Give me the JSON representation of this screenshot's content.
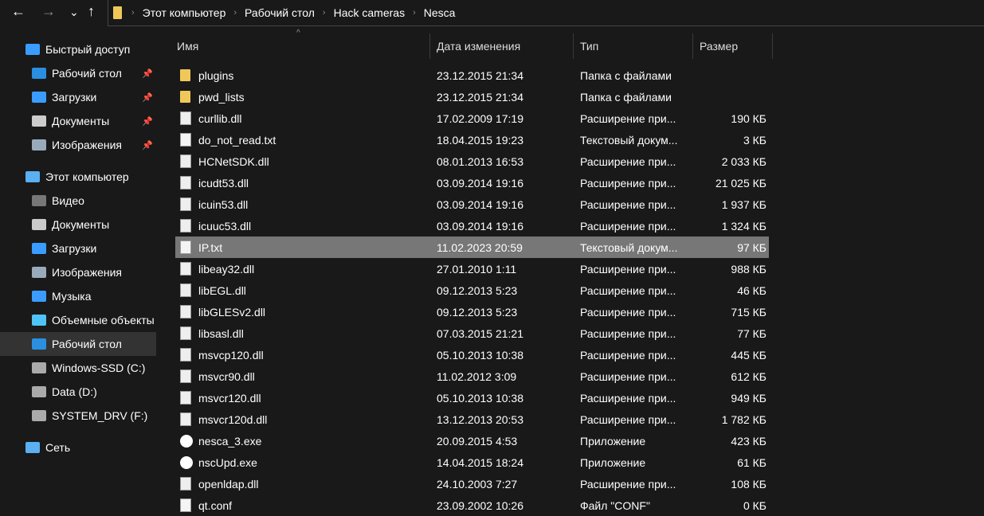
{
  "nav": {
    "back": "←",
    "forward": "→",
    "recent": "⌄",
    "up": "↑"
  },
  "breadcrumb": [
    "Этот компьютер",
    "Рабочий стол",
    "Hack cameras",
    "Nesca"
  ],
  "sidebar": [
    {
      "label": "Быстрый доступ",
      "icon": "star-icon",
      "color": "#3b9cff",
      "pin": false,
      "indent": false
    },
    {
      "label": "Рабочий стол",
      "icon": "desktop-icon",
      "color": "#2a8fe0",
      "pin": true,
      "indent": true
    },
    {
      "label": "Загрузки",
      "icon": "download-icon",
      "color": "#3b9cff",
      "pin": true,
      "indent": true
    },
    {
      "label": "Документы",
      "icon": "document-icon",
      "color": "#ccc",
      "pin": true,
      "indent": true
    },
    {
      "label": "Изображения",
      "icon": "pictures-icon",
      "color": "#9ab",
      "pin": true,
      "indent": true
    },
    {
      "label": "Этот компьютер",
      "icon": "computer-icon",
      "color": "#5ab0f0",
      "pin": false,
      "indent": false
    },
    {
      "label": "Видео",
      "icon": "video-icon",
      "color": "#777",
      "pin": false,
      "indent": true
    },
    {
      "label": "Документы",
      "icon": "document-icon",
      "color": "#ccc",
      "pin": false,
      "indent": true
    },
    {
      "label": "Загрузки",
      "icon": "download-icon",
      "color": "#3b9cff",
      "pin": false,
      "indent": true
    },
    {
      "label": "Изображения",
      "icon": "pictures-icon",
      "color": "#9ab",
      "pin": false,
      "indent": true
    },
    {
      "label": "Музыка",
      "icon": "music-icon",
      "color": "#3b9cff",
      "pin": false,
      "indent": true
    },
    {
      "label": "Объемные объекты",
      "icon": "3d-objects-icon",
      "color": "#4fc3f7",
      "pin": false,
      "indent": true
    },
    {
      "label": "Рабочий стол",
      "icon": "desktop-icon",
      "color": "#2a8fe0",
      "pin": false,
      "indent": true,
      "selected": true
    },
    {
      "label": "Windows-SSD (C:)",
      "icon": "drive-icon",
      "color": "#aaa",
      "pin": false,
      "indent": true
    },
    {
      "label": "Data (D:)",
      "icon": "drive-icon",
      "color": "#aaa",
      "pin": false,
      "indent": true
    },
    {
      "label": "SYSTEM_DRV (F:)",
      "icon": "drive-icon",
      "color": "#aaa",
      "pin": false,
      "indent": true
    },
    {
      "label": "Сеть",
      "icon": "network-icon",
      "color": "#5ab0f0",
      "pin": false,
      "indent": false
    }
  ],
  "columns": {
    "name": "Имя",
    "date": "Дата изменения",
    "type": "Тип",
    "size": "Размер"
  },
  "files": [
    {
      "name": "plugins",
      "date": "23.12.2015 21:34",
      "type": "Папка с файлами",
      "size": "",
      "kind": "folder"
    },
    {
      "name": "pwd_lists",
      "date": "23.12.2015 21:34",
      "type": "Папка с файлами",
      "size": "",
      "kind": "folder"
    },
    {
      "name": "curllib.dll",
      "date": "17.02.2009 17:19",
      "type": "Расширение при...",
      "size": "190 КБ",
      "kind": "dll"
    },
    {
      "name": "do_not_read.txt",
      "date": "18.04.2015 19:23",
      "type": "Текстовый докум...",
      "size": "3 КБ",
      "kind": "file"
    },
    {
      "name": "HCNetSDK.dll",
      "date": "08.01.2013 16:53",
      "type": "Расширение при...",
      "size": "2 033 КБ",
      "kind": "dll"
    },
    {
      "name": "icudt53.dll",
      "date": "03.09.2014 19:16",
      "type": "Расширение при...",
      "size": "21 025 КБ",
      "kind": "dll"
    },
    {
      "name": "icuin53.dll",
      "date": "03.09.2014 19:16",
      "type": "Расширение при...",
      "size": "1 937 КБ",
      "kind": "dll"
    },
    {
      "name": "icuuc53.dll",
      "date": "03.09.2014 19:16",
      "type": "Расширение при...",
      "size": "1 324 КБ",
      "kind": "dll"
    },
    {
      "name": "IP.txt",
      "date": "11.02.2023 20:59",
      "type": "Текстовый докум...",
      "size": "97 КБ",
      "kind": "file",
      "selected": true
    },
    {
      "name": "libeay32.dll",
      "date": "27.01.2010 1:11",
      "type": "Расширение при...",
      "size": "988 КБ",
      "kind": "dll"
    },
    {
      "name": "libEGL.dll",
      "date": "09.12.2013 5:23",
      "type": "Расширение при...",
      "size": "46 КБ",
      "kind": "dll"
    },
    {
      "name": "libGLESv2.dll",
      "date": "09.12.2013 5:23",
      "type": "Расширение при...",
      "size": "715 КБ",
      "kind": "dll"
    },
    {
      "name": "libsasl.dll",
      "date": "07.03.2015 21:21",
      "type": "Расширение при...",
      "size": "77 КБ",
      "kind": "dll"
    },
    {
      "name": "msvcp120.dll",
      "date": "05.10.2013 10:38",
      "type": "Расширение при...",
      "size": "445 КБ",
      "kind": "dll"
    },
    {
      "name": "msvcr90.dll",
      "date": "11.02.2012 3:09",
      "type": "Расширение при...",
      "size": "612 КБ",
      "kind": "dll"
    },
    {
      "name": "msvcr120.dll",
      "date": "05.10.2013 10:38",
      "type": "Расширение при...",
      "size": "949 КБ",
      "kind": "dll"
    },
    {
      "name": "msvcr120d.dll",
      "date": "13.12.2013 20:53",
      "type": "Расширение при...",
      "size": "1 782 КБ",
      "kind": "dll"
    },
    {
      "name": "nesca_3.exe",
      "date": "20.09.2015 4:53",
      "type": "Приложение",
      "size": "423 КБ",
      "kind": "exe"
    },
    {
      "name": "nscUpd.exe",
      "date": "14.04.2015 18:24",
      "type": "Приложение",
      "size": "61 КБ",
      "kind": "exe"
    },
    {
      "name": "openldap.dll",
      "date": "24.10.2003 7:27",
      "type": "Расширение при...",
      "size": "108 КБ",
      "kind": "dll"
    },
    {
      "name": "qt.conf",
      "date": "23.09.2002 10:26",
      "type": "Файл \"CONF\"",
      "size": "0 КБ",
      "kind": "file"
    }
  ]
}
